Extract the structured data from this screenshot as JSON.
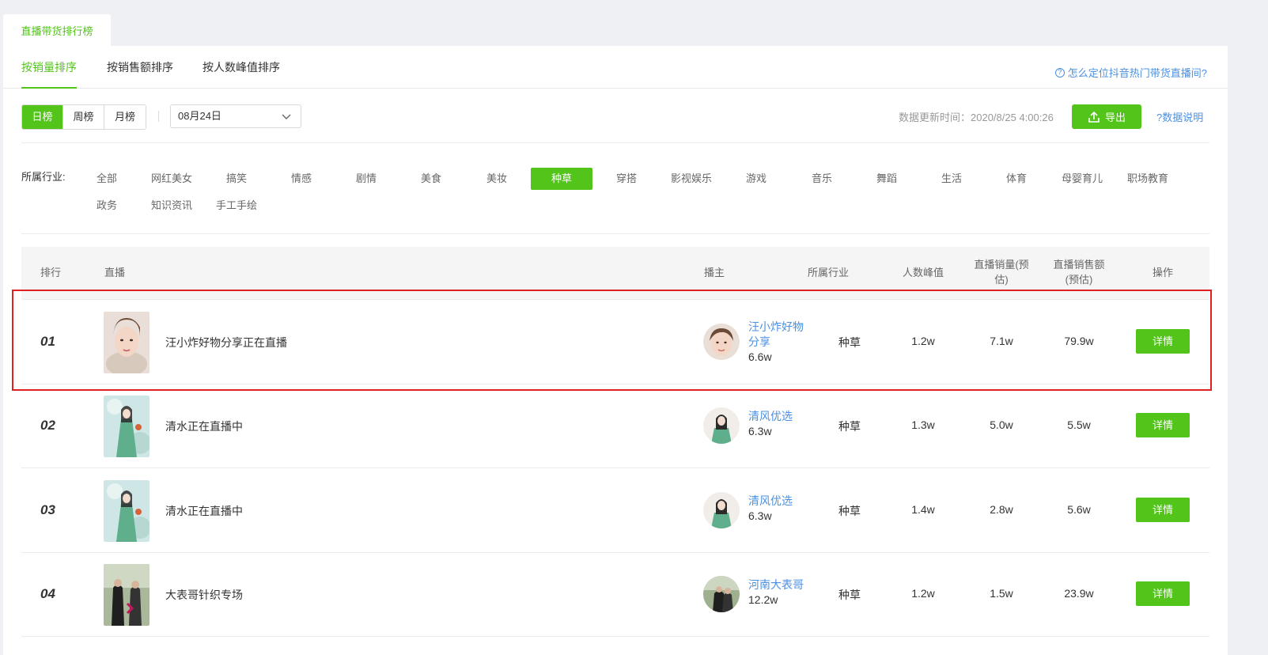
{
  "top_tab": "直播带货排行榜",
  "sort_tabs": [
    "按销量排序",
    "按销售额排序",
    "按人数峰值排序"
  ],
  "help_link": "怎么定位抖音热门带货直播间?",
  "periods": [
    "日榜",
    "周榜",
    "月榜"
  ],
  "date_value": "08月24日",
  "update_time": "数据更新时间：2020/8/25 4:00:26",
  "export_label": "导出",
  "data_note": "?数据说明",
  "industry_label": "所属行业:",
  "industries": [
    "全部",
    "网红美女",
    "搞笑",
    "情感",
    "剧情",
    "美食",
    "美妆",
    "种草",
    "穿搭",
    "影视娱乐",
    "游戏",
    "音乐",
    "舞蹈",
    "生活",
    "体育",
    "母婴育儿",
    "职场教育",
    "政务",
    "知识资讯",
    "手工手绘"
  ],
  "active_industry": "种草",
  "colors": {
    "accent": "#52c41a",
    "link": "#4a90e2",
    "highlight": "#e02020"
  },
  "table": {
    "headers": {
      "rank": "排行",
      "live": "直播",
      "anchor": "播主",
      "industry": "所属行业",
      "peak": "人数峰值",
      "volume_line1": "直播销量(预",
      "volume_line2": "估)",
      "amount_line1": "直播销售额",
      "amount_line2": "(预估)",
      "action": "操作"
    },
    "rows": [
      {
        "rank": "01",
        "title": "汪小炸好物分享正在直播",
        "anchor_line1": "汪小炸好物",
        "anchor_line2": "分享",
        "fans": "6.6w",
        "industry": "种草",
        "peak": "1.2w",
        "volume": "7.1w",
        "amount": "79.9w",
        "action": "详情"
      },
      {
        "rank": "02",
        "title": "清水正在直播中",
        "anchor_line1": "清风优选",
        "anchor_line2": "",
        "fans": "6.3w",
        "industry": "种草",
        "peak": "1.3w",
        "volume": "5.0w",
        "amount": "5.5w",
        "action": "详情"
      },
      {
        "rank": "03",
        "title": "清水正在直播中",
        "anchor_line1": "清风优选",
        "anchor_line2": "",
        "fans": "6.3w",
        "industry": "种草",
        "peak": "1.4w",
        "volume": "2.8w",
        "amount": "5.6w",
        "action": "详情"
      },
      {
        "rank": "04",
        "title": "大表哥针织专场",
        "anchor_line1": "河南大表哥",
        "anchor_line2": "",
        "fans": "12.2w",
        "industry": "种草",
        "peak": "1.2w",
        "volume": "1.5w",
        "amount": "23.9w",
        "action": "详情"
      }
    ]
  }
}
